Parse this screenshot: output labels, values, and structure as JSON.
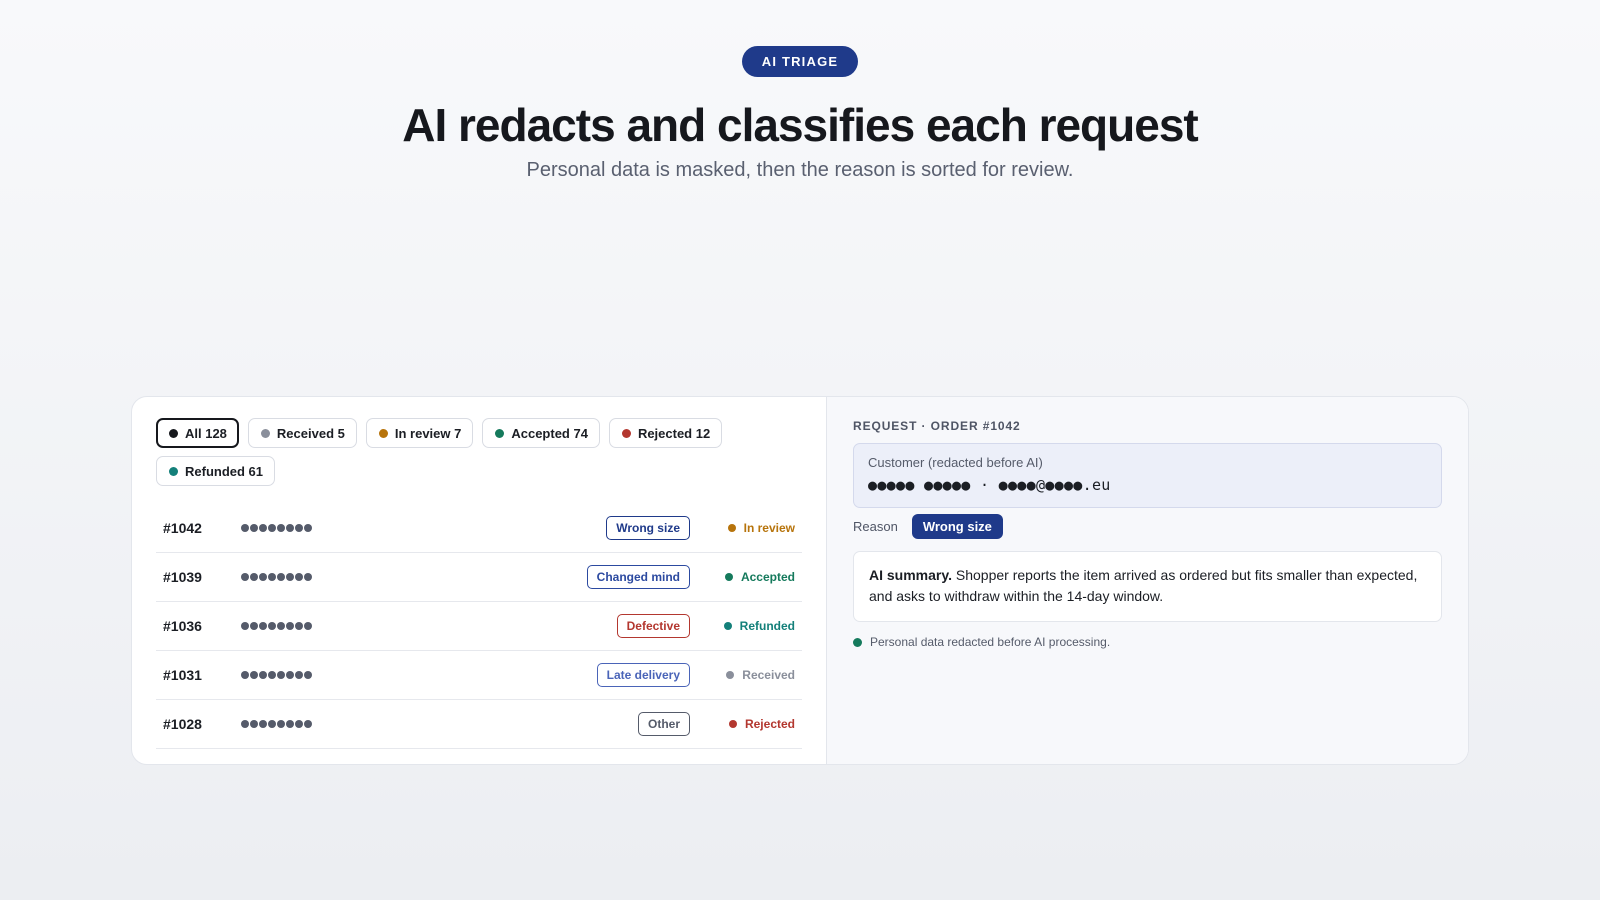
{
  "hero": {
    "badge": "AI TRIAGE",
    "title": "AI redacts and classifies each request",
    "subtitle": "Personal data is masked, then the reason is sorted for review."
  },
  "colors": {
    "brand": "#1f3a8a",
    "all": "#16181d",
    "received": "#8a8f9b",
    "in_review": "#b7740c",
    "accepted": "#157a5c",
    "rejected": "#b3372f",
    "refunded": "#14807a"
  },
  "filters": [
    {
      "label": "All 128",
      "color": "#16181d",
      "active": true
    },
    {
      "label": "Received 5",
      "color": "#8a8f9b",
      "active": false
    },
    {
      "label": "In review 7",
      "color": "#b7740c",
      "active": false
    },
    {
      "label": "Accepted 74",
      "color": "#157a5c",
      "active": false
    },
    {
      "label": "Rejected 12",
      "color": "#b3372f",
      "active": false
    },
    {
      "label": "Refunded 61",
      "color": "#14807a",
      "active": false
    }
  ],
  "rows": [
    {
      "id": "#1042",
      "masked": "●●●●●●●●",
      "reason": "Wrong size",
      "reason_color": "#1f3a8a",
      "status": "In review",
      "status_color": "#b7740c"
    },
    {
      "id": "#1039",
      "masked": "●●●●●●●●",
      "reason": "Changed mind",
      "reason_color": "#2c4aa0",
      "status": "Accepted",
      "status_color": "#157a5c"
    },
    {
      "id": "#1036",
      "masked": "●●●●●●●●",
      "reason": "Defective",
      "reason_color": "#b3372f",
      "status": "Refunded",
      "status_color": "#14807a"
    },
    {
      "id": "#1031",
      "masked": "●●●●●●●●",
      "reason": "Late delivery",
      "reason_color": "#4a64b8",
      "status": "Received",
      "status_color": "#8a8f9b"
    },
    {
      "id": "#1028",
      "masked": "●●●●●●●●",
      "reason": "Other",
      "reason_color": "#555b6a",
      "status": "Rejected",
      "status_color": "#b3372f"
    }
  ],
  "detail": {
    "request_label": "REQUEST · ORDER #1042",
    "customer_label": "Customer (redacted before AI)",
    "customer_value": "●●●●● ●●●●● · ●●●●@●●●●.eu",
    "reason_label": "Reason",
    "reason_value": "Wrong size",
    "summary_bold": "AI summary.",
    "summary_text": " Shopper reports the item arrived as ordered but fits smaller than expected, and asks to withdraw within the 14-day window.",
    "footnote": "Personal data redacted before AI processing."
  }
}
